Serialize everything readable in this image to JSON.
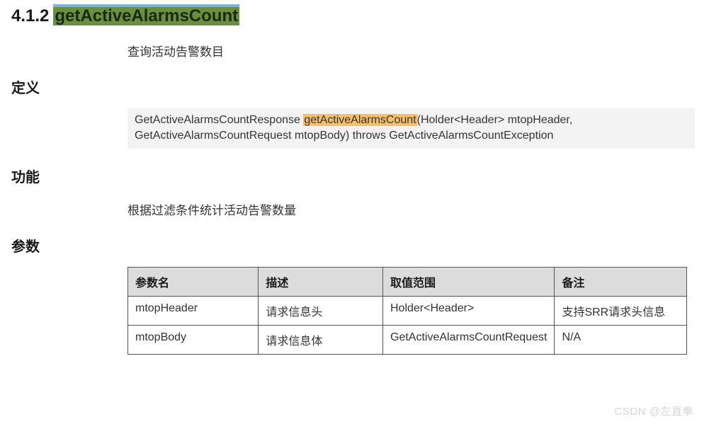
{
  "heading": {
    "number": "4.1.2",
    "name": "getActiveAlarmsCount"
  },
  "summary": "查询活动告警数目",
  "sections": {
    "definition": {
      "label": "定义",
      "code_pre": "GetActiveAlarmsCountResponse ",
      "code_hl": "getActiveAlarmsCount",
      "code_post1": "(Holder<Header> mtopHeader,",
      "code_post2": "GetActiveAlarmsCountRequest mtopBody) throws GetActiveAlarmsCountException"
    },
    "function": {
      "label": "功能",
      "text": "根据过滤条件统计活动告警数量"
    },
    "params": {
      "label": "参数",
      "headers": {
        "name": "参数名",
        "desc": "描述",
        "range": "取值范围",
        "note": "备注"
      },
      "rows": [
        {
          "name": "mtopHeader",
          "desc": "请求信息头",
          "range": "Holder<Header>",
          "note": "支持SRR请求头信息"
        },
        {
          "name": "mtopBody",
          "desc": "请求信息体",
          "range": "GetActiveAlarmsCountRequest",
          "note": "N/A"
        }
      ]
    }
  },
  "watermark": "CSDN @左直拳"
}
